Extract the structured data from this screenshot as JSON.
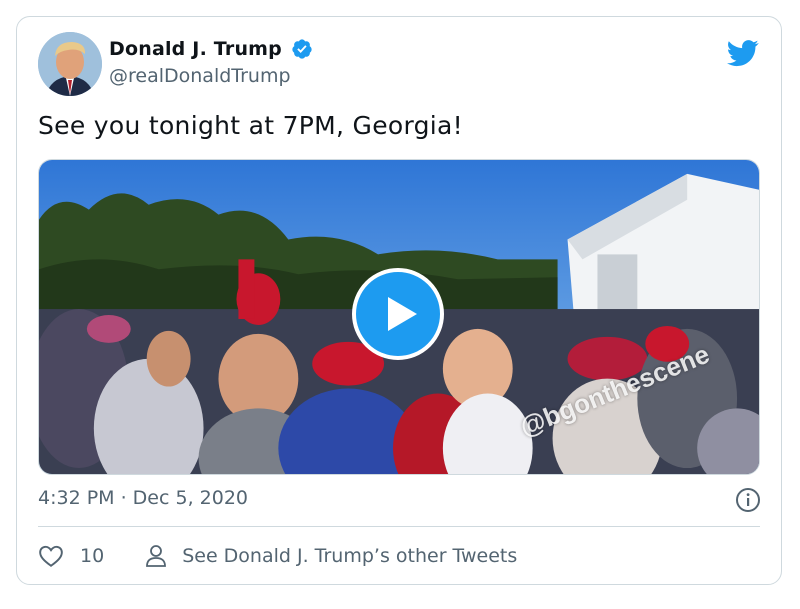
{
  "tweet": {
    "author_name": "Donald J. Trump",
    "author_handle": "@realDonaldTrump",
    "text": "See you tonight at 7PM, Georgia!",
    "timestamp": "4:32 PM · Dec 5, 2020",
    "like_count": "10",
    "other_tweets_label": "See Donald J. Trump’s other Tweets",
    "video_watermark": "@bgonthescene"
  },
  "icons": {
    "verified": "verified-badge-icon",
    "brand": "twitter-bird-icon",
    "play": "play-icon",
    "info": "info-icon",
    "like": "heart-icon",
    "profile": "person-icon"
  },
  "colors": {
    "accent": "#1d9bf0",
    "text_primary": "#0f1419",
    "text_secondary": "#536471",
    "border": "#cfd9de"
  }
}
